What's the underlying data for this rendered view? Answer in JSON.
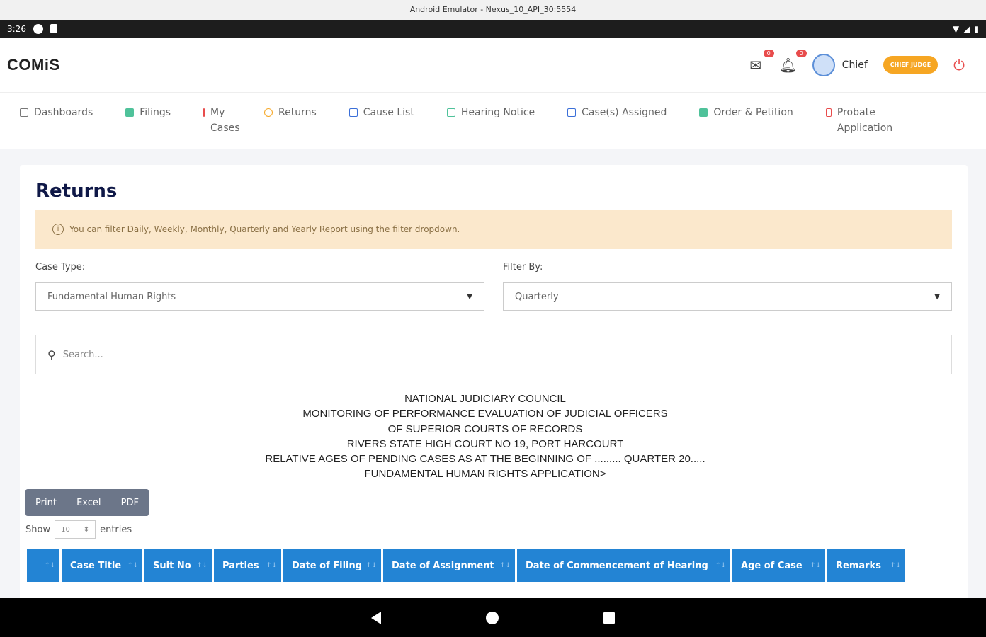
{
  "emulator": {
    "title": "Android Emulator - Nexus_10_API_30:5554"
  },
  "status_bar": {
    "time": "3:26"
  },
  "app": {
    "logo": "COMiS",
    "header": {
      "mail_badge": "0",
      "bell_badge": "0",
      "user_name": "Chief",
      "role_badge": "CHIEF JUDGE"
    },
    "nav": [
      {
        "label": "Dashboards",
        "color": "#777777"
      },
      {
        "label": "Filings",
        "color": "#4fc29a"
      },
      {
        "label": "My Cases",
        "color": "#e84c4c"
      },
      {
        "label": "Returns",
        "color": "#f6a623"
      },
      {
        "label": "Cause List",
        "color": "#3b6fd8"
      },
      {
        "label": "Hearing Notice",
        "color": "#4fc29a"
      },
      {
        "label": "Case(s) Assigned",
        "color": "#3b6fd8"
      },
      {
        "label": "Order & Petition",
        "color": "#4fc29a"
      },
      {
        "label": "Probate Application",
        "color": "#e84c4c"
      }
    ],
    "page_title": "Returns",
    "alert_text": "You can filter Daily, Weekly, Monthly, Quarterly and Yearly Report using the filter dropdown.",
    "case_type": {
      "label": "Case Type:",
      "value": "Fundamental Human Rights"
    },
    "filter_by": {
      "label": "Filter By:",
      "value": "Quarterly"
    },
    "search": {
      "placeholder": "Search..."
    },
    "report_header": [
      "NATIONAL JUDICIARY COUNCIL",
      "MONITORING OF PERFORMANCE EVALUATION OF JUDICIAL OFFICERS",
      "OF SUPERIOR COURTS OF RECORDS",
      "RIVERS STATE HIGH COURT NO 19, PORT HARCOURT",
      "RELATIVE AGES OF PENDING CASES AS AT THE BEGINNING OF ......... QUARTER 20.....",
      "FUNDAMENTAL HUMAN RIGHTS APPLICATION>"
    ],
    "export": {
      "print": "Print",
      "excel": "Excel",
      "pdf": "PDF"
    },
    "entries": {
      "show": "Show",
      "value": "10",
      "suffix": "entries"
    },
    "table_columns": [
      "",
      "Case Title",
      "Suit No",
      "Parties",
      "Date of Filing",
      "Date of Assignment",
      "Date of Commencement of Hearing",
      "Age of Case",
      "Remarks"
    ]
  },
  "colors": {
    "accent": "#2384d4",
    "title": "#0f1847",
    "warning_bg": "#fbe8cc",
    "role": "#f6a623"
  }
}
